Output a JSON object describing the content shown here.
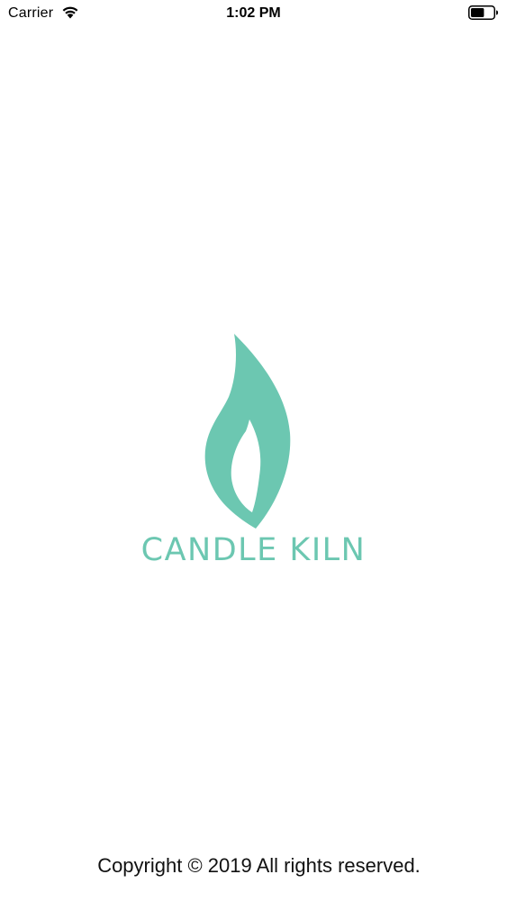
{
  "status_bar": {
    "carrier": "Carrier",
    "time": "1:02 PM",
    "wifi_icon": "wifi-icon",
    "battery_icon": "battery-icon",
    "battery_level": 0.6
  },
  "splash": {
    "logo_icon": "flame-icon",
    "brand_name": "CANDLE KILN",
    "brand_color": "#6cc7b1"
  },
  "footer": {
    "copyright": "Copyright © 2019 All rights reserved."
  }
}
